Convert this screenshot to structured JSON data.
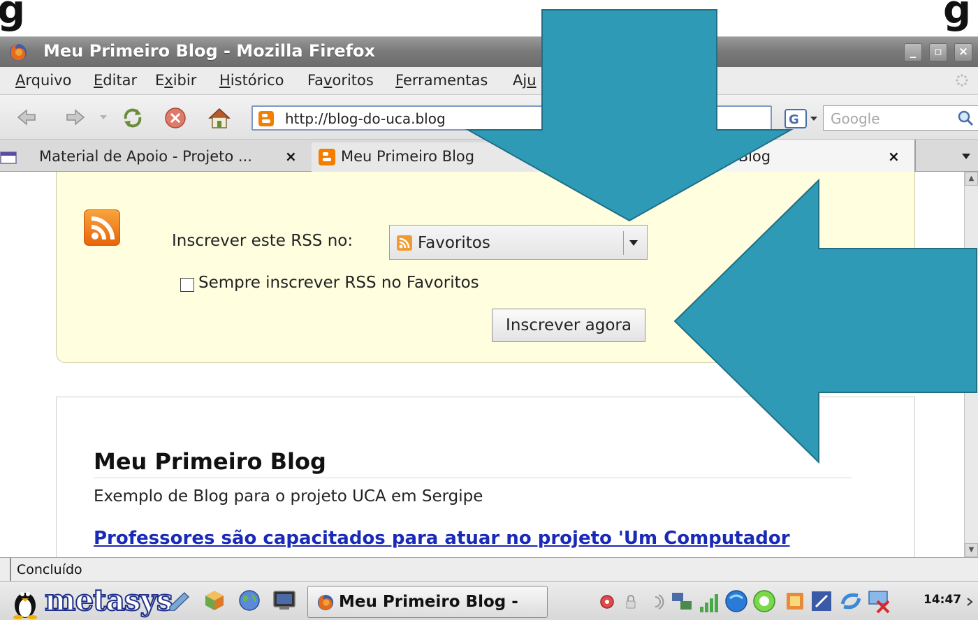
{
  "window": {
    "title": "Meu Primeiro Blog - Mozilla Firefox"
  },
  "menu": [
    {
      "label": "Arquivo",
      "u": "A",
      "rest": "rquivo"
    },
    {
      "label": "Editar",
      "u": "E",
      "rest": "ditar"
    },
    {
      "label": "Exibir",
      "pre": "E",
      "u": "x",
      "rest": "ibir"
    },
    {
      "label": "Histórico",
      "u": "H",
      "rest": "istórico"
    },
    {
      "label": "Favoritos",
      "pre": "Fa",
      "u": "v",
      "rest": "oritos"
    },
    {
      "label": "Ferramentas",
      "u": "F",
      "rest": "erramentas"
    },
    {
      "label": "Aju",
      "pre": "Aj",
      "u": "u",
      "rest": ""
    }
  ],
  "navbar": {
    "url": "http://blog-do-uca.blog",
    "search_placeholder": "Google"
  },
  "tabs": [
    {
      "label": "Material de Apoio - Projeto ...",
      "close": "×"
    },
    {
      "label": "Meu Primeiro Blog",
      "close": ""
    },
    {
      "label": "ro Blog",
      "close": "×"
    }
  ],
  "rss_subscribe": {
    "label": "Inscrever este RSS no:",
    "selected_reader": "Favoritos",
    "always_label": "Sempre inscrever RSS no Favoritos",
    "always_checked": false,
    "button_label": "Inscrever agora"
  },
  "blog": {
    "title": "Meu Primeiro Blog",
    "description": "Exemplo de Blog para o projeto UCA em Sergipe",
    "post_link": "Professores são capacitados para atuar no projeto 'Um Computador"
  },
  "status": {
    "text": "Concluído"
  },
  "taskbar": {
    "logo": "metasys",
    "task_label": "Meu Primeiro Blog -",
    "clock": "14:47"
  },
  "colors": {
    "arrow_fill": "#2e9ab5",
    "arrow_stroke": "#1f6f86",
    "rss_bg": "#ffffe0",
    "link": "#1a2ab8"
  },
  "icons": [
    "firefox-icon",
    "back-icon",
    "forward-icon",
    "reload-icon",
    "stop-icon",
    "home-icon",
    "blogger-icon",
    "rss-icon",
    "search-icon",
    "close-icon"
  ]
}
